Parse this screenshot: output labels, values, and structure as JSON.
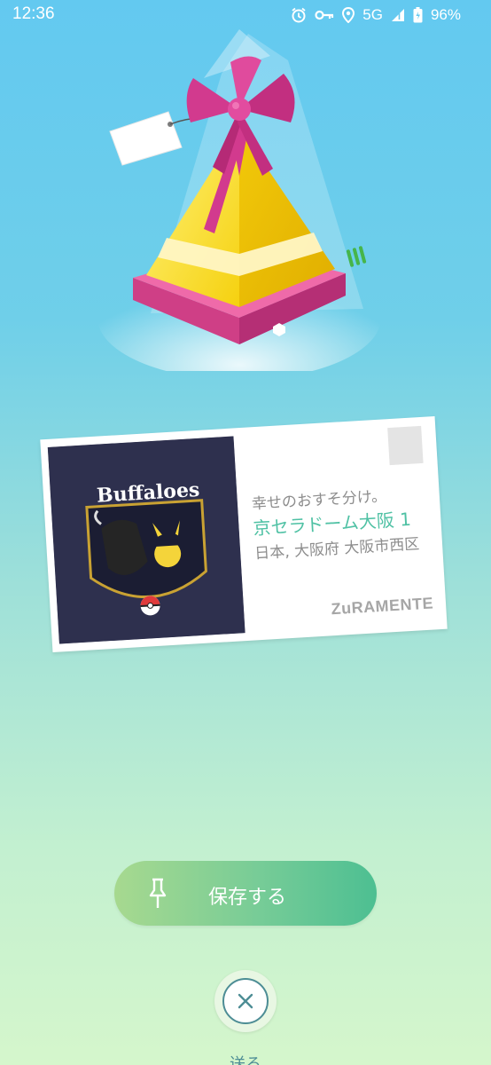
{
  "status_bar": {
    "time": "12:36",
    "network": "5G",
    "battery": "96%",
    "icons": [
      "alarm-icon",
      "vpn-key-icon",
      "location-icon",
      "signal-icon",
      "battery-icon"
    ]
  },
  "gift": {
    "icon": "gift-icon",
    "colors": {
      "bow": "#d23a8e",
      "body": "#f7dc1c",
      "base": "#e8559c",
      "tag": "#ffffff"
    }
  },
  "postcard": {
    "photo": {
      "icon": "postcard-photo",
      "logo_text": "Buffaloes"
    },
    "message": "幸せのおすそ分け。",
    "location_name": "京セラドーム大阪 1",
    "location_address": "日本, 大阪府 大阪市西区",
    "sender": "ZuRAMENTE"
  },
  "actions": {
    "save_label": "保存する",
    "save_icon": "pin-icon",
    "close_icon": "close-icon",
    "bottom_label": "送る"
  },
  "colors": {
    "accent_green": "#4fc1a4",
    "button_start": "#a7d98f",
    "button_end": "#4dbf92",
    "close_stroke": "#4d8d95"
  }
}
